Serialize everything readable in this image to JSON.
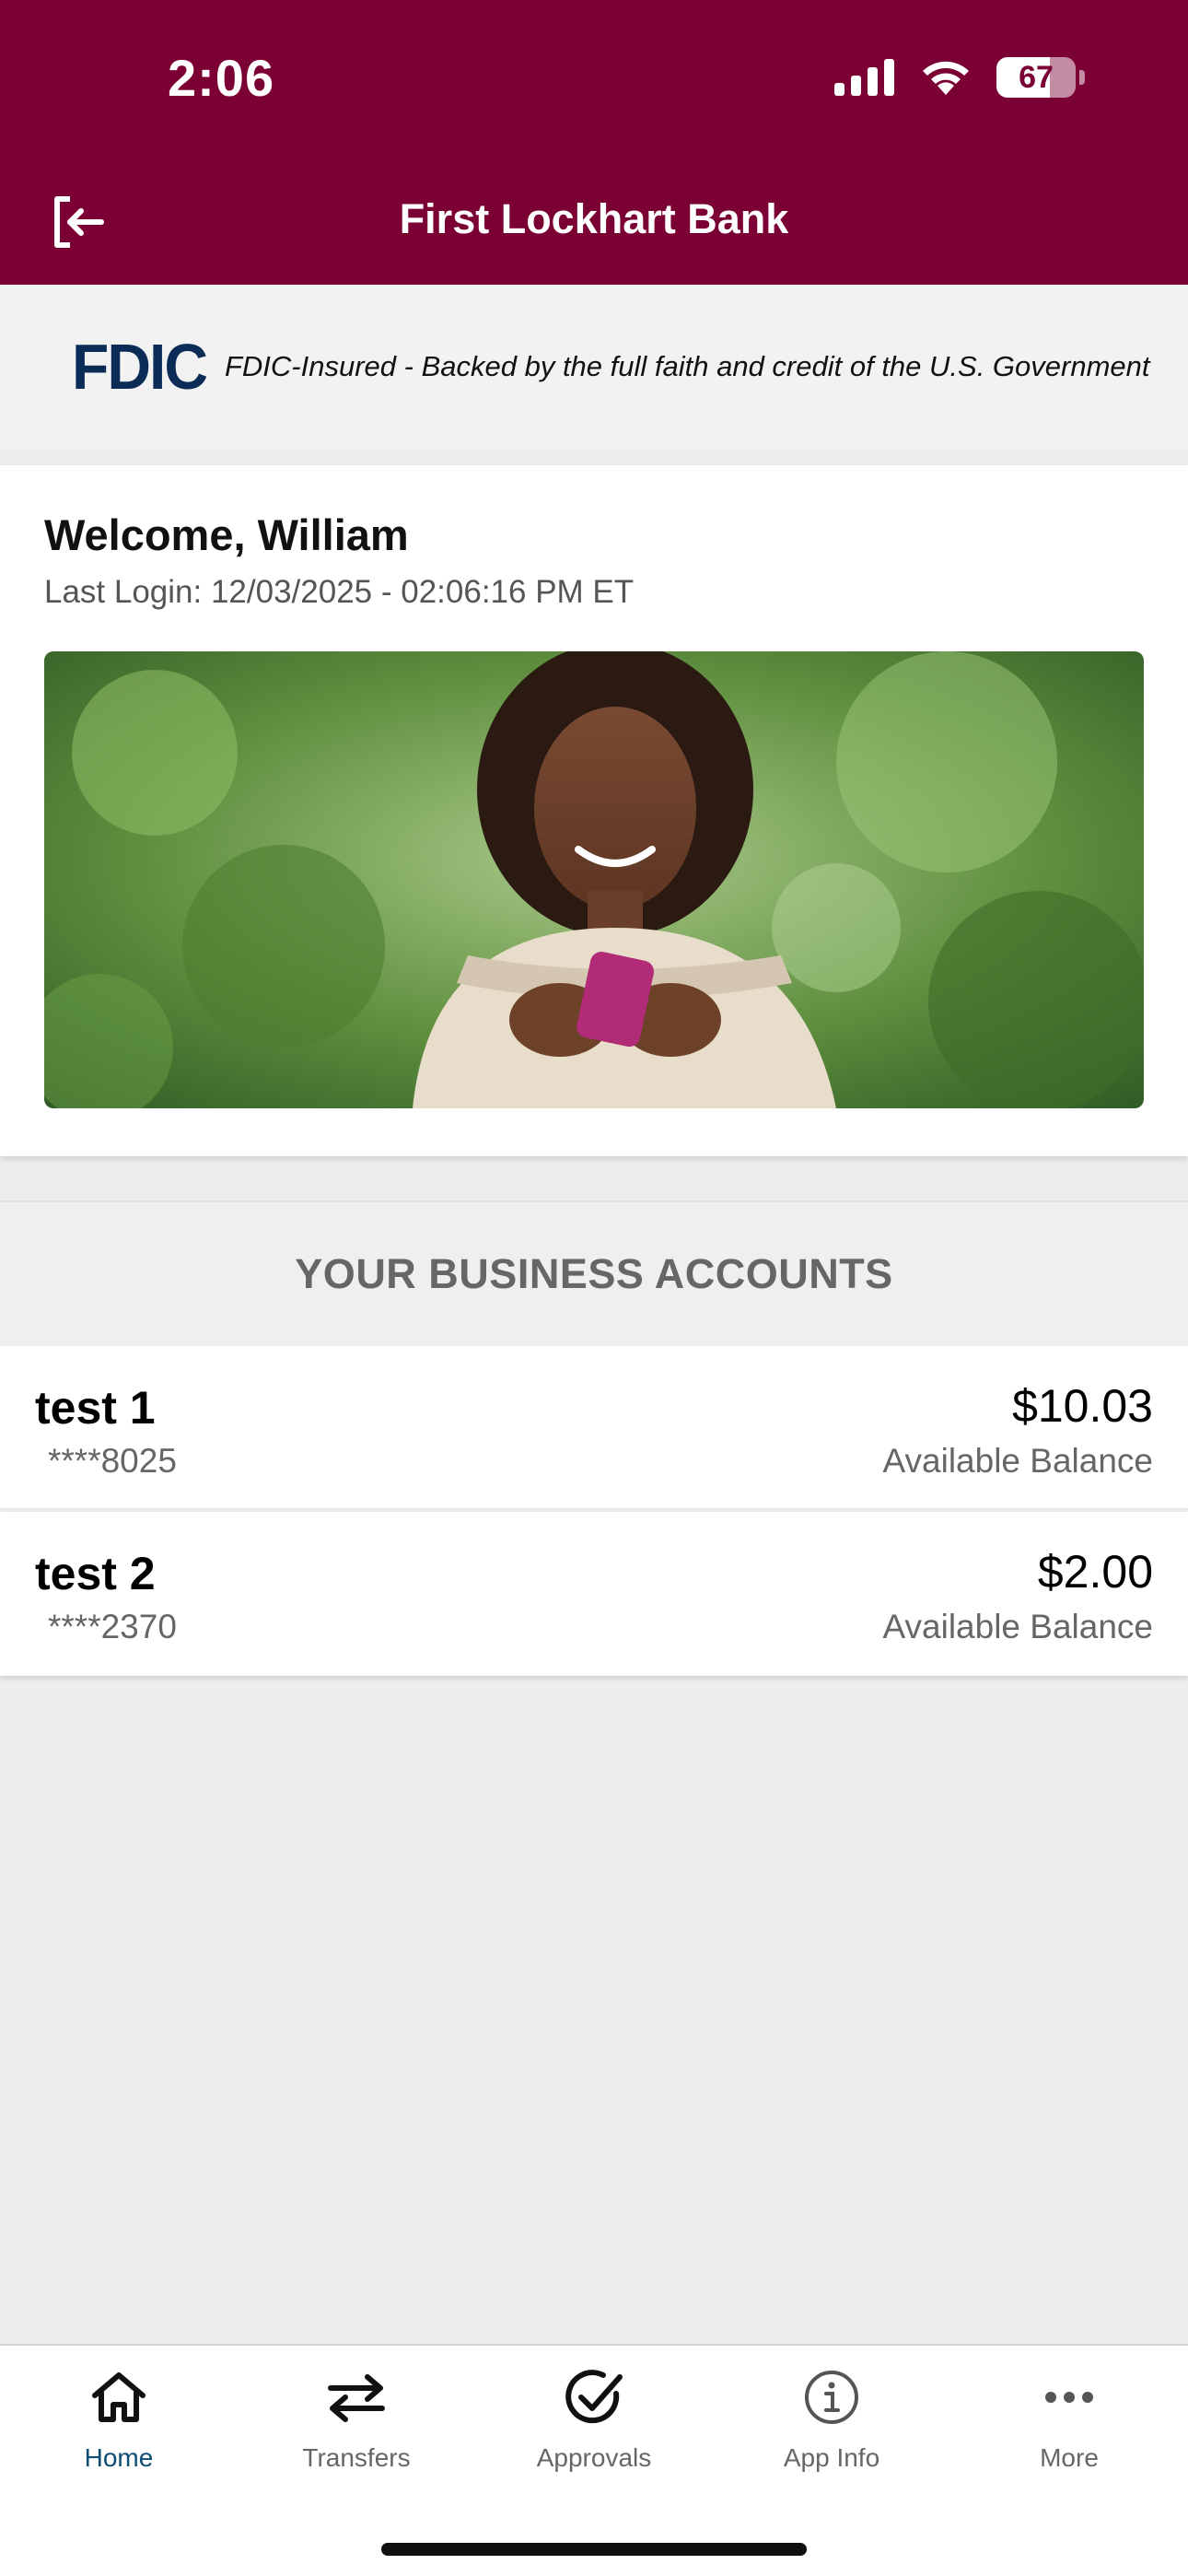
{
  "status_bar": {
    "time": "2:06",
    "battery_level": "67",
    "battery_fraction": 0.67,
    "icons": [
      "signal-icon",
      "wifi-icon",
      "battery-icon"
    ]
  },
  "header": {
    "title": "First Lockhart Bank",
    "logout_icon": "logout-icon",
    "background_color": "#7b0033"
  },
  "fdic_banner": {
    "logo_text": "FDIC",
    "text": "FDIC-Insured - Backed by the full faith and credit of the U.S. Government"
  },
  "welcome": {
    "title": "Welcome, William",
    "last_login": "Last Login: 12/03/2025 - 02:06:16 PM ET"
  },
  "accounts": {
    "section_title": "YOUR BUSINESS ACCOUNTS",
    "items": [
      {
        "name": "test 1",
        "number": "****8025",
        "amount": "$10.03",
        "label": "Available Balance"
      },
      {
        "name": "test 2",
        "number": "****2370",
        "amount": "$2.00",
        "label": "Available Balance"
      }
    ]
  },
  "tab_bar": {
    "active_color": "#0b4d73",
    "tabs": [
      {
        "label": "Home",
        "icon": "home-icon",
        "active": true
      },
      {
        "label": "Transfers",
        "icon": "transfers-icon",
        "active": false
      },
      {
        "label": "Approvals",
        "icon": "approvals-check-icon",
        "active": false
      },
      {
        "label": "App Info",
        "icon": "info-icon",
        "active": false
      },
      {
        "label": "More",
        "icon": "more-dots-icon",
        "active": false
      }
    ]
  }
}
